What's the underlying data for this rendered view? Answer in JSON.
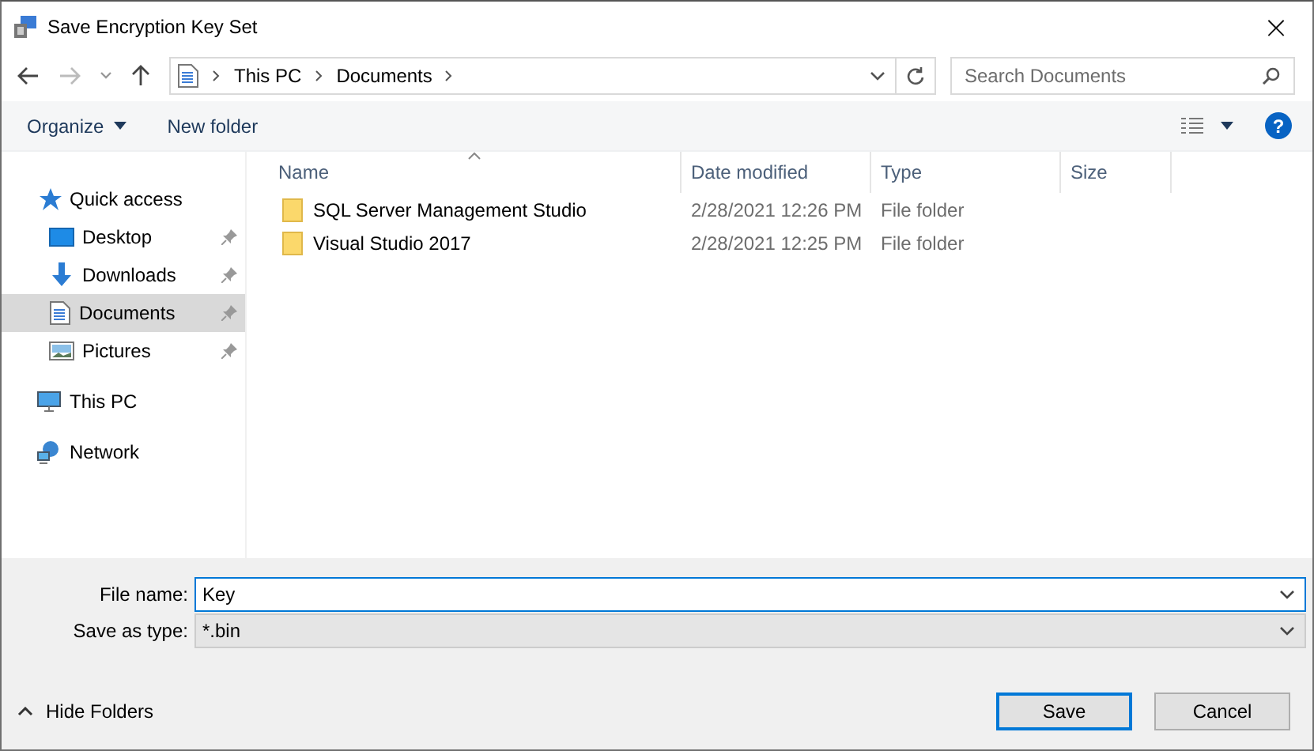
{
  "window": {
    "title": "Save Encryption Key Set",
    "close": "×"
  },
  "address": {
    "crumbs": [
      "This PC",
      "Documents"
    ]
  },
  "search": {
    "placeholder": "Search Documents"
  },
  "toolbar": {
    "organize": "Organize",
    "new_folder": "New folder",
    "help": "?"
  },
  "sidebar": {
    "items": [
      {
        "label": "Quick access",
        "kind": "group",
        "selected": false,
        "children": [
          {
            "label": "Desktop",
            "pinned": true,
            "selected": false
          },
          {
            "label": "Downloads",
            "pinned": true,
            "selected": false
          },
          {
            "label": "Documents",
            "pinned": true,
            "selected": true
          },
          {
            "label": "Pictures",
            "pinned": true,
            "selected": false
          }
        ]
      },
      {
        "label": "This PC",
        "kind": "group",
        "selected": false
      },
      {
        "label": "Network",
        "kind": "group",
        "selected": false
      }
    ]
  },
  "table": {
    "columns": [
      "Name",
      "Date modified",
      "Type",
      "Size"
    ],
    "rows": [
      {
        "name": "SQL Server Management Studio",
        "date": "2/28/2021 12:26 PM",
        "type": "File folder"
      },
      {
        "name": "Visual Studio 2017",
        "date": "2/28/2021 12:25 PM",
        "type": "File folder"
      }
    ]
  },
  "form": {
    "file_name_label": "File name:",
    "file_name": "Key",
    "type_label": "Save as type:",
    "type_value": "*.bin"
  },
  "footer": {
    "hide_folders": "Hide Folders",
    "buttons": [
      {
        "label": "Save",
        "default": true
      },
      {
        "label": "Cancel",
        "default": false
      }
    ]
  }
}
